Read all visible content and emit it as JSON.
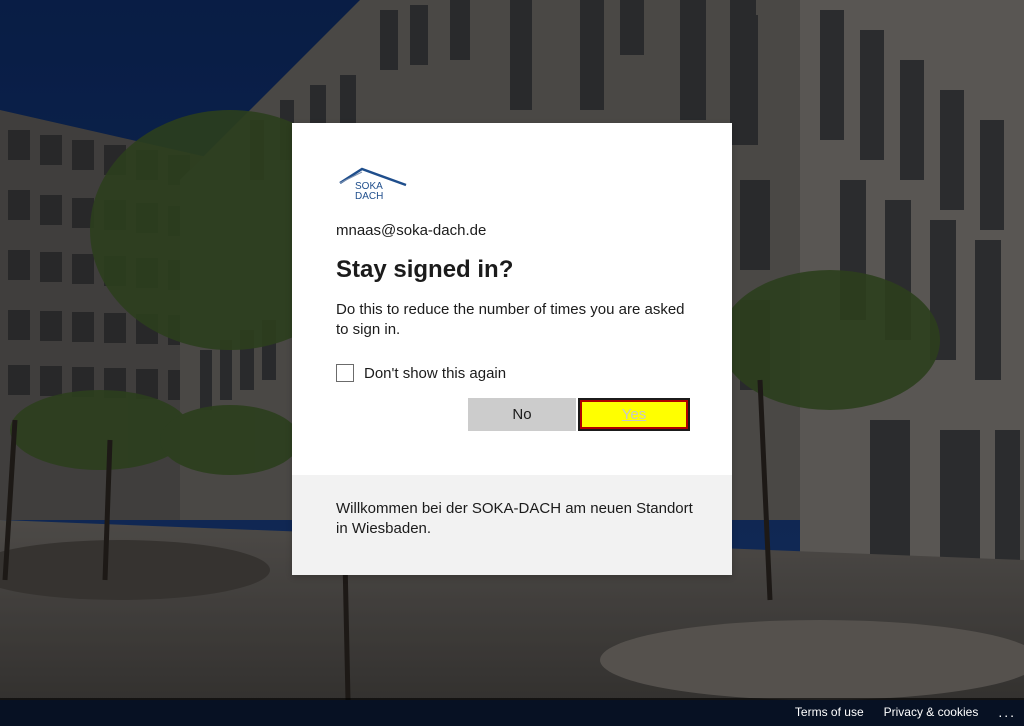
{
  "account": {
    "email": "mnaas@soka-dach.de"
  },
  "logo": {
    "line1": "SOKA",
    "line2": "DACH",
    "color": "#1f4e8c"
  },
  "dialog": {
    "title": "Stay signed in?",
    "description": "Do this to reduce the number of times you are asked to sign in.",
    "checkbox_label": "Don't show this again",
    "checkbox_checked": false,
    "no_label": "No",
    "yes_label": "Yes"
  },
  "footer": {
    "message": "Willkommen bei der SOKA-DACH am neuen Standort in Wiesbaden."
  },
  "bottom_bar": {
    "terms_label": "Terms of use",
    "privacy_label": "Privacy & cookies",
    "more_label": "..."
  },
  "colors": {
    "yes_bg": "#ffff00",
    "no_bg": "#cccccc",
    "footer_bg": "#f2f2f2"
  },
  "icons": {
    "more": "more-options-icon",
    "logo": "soka-dach-logo"
  }
}
